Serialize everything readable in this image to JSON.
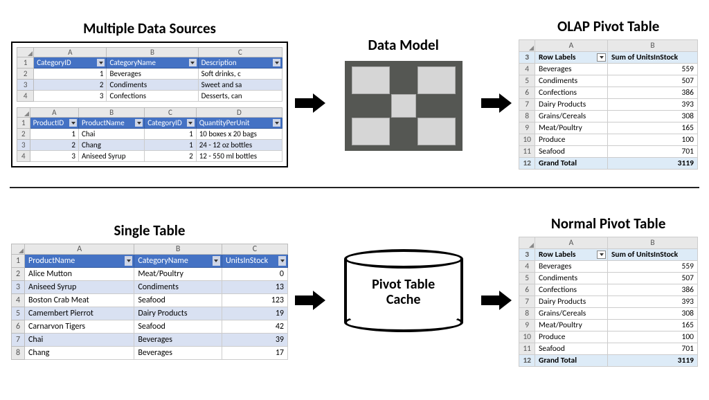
{
  "titles": {
    "multi": "Multiple Data Sources",
    "model": "Data Model",
    "olap": "OLAP Pivot Table",
    "single": "Single Table",
    "normal": "Normal Pivot Table"
  },
  "cache_label_1": "Pivot Table",
  "cache_label_2": "Cache",
  "src1": {
    "cols": [
      "A",
      "B",
      "C"
    ],
    "headers": [
      "CategoryID",
      "CategoryName",
      "Description"
    ],
    "rows": [
      {
        "n": "1",
        "id": "1",
        "name": "Beverages",
        "desc": "Soft drinks, c"
      },
      {
        "n": "2",
        "id": "2",
        "name": "Condiments",
        "desc": "Sweet and sa"
      },
      {
        "n": "3",
        "id": "3",
        "name": "Confections",
        "desc": "Desserts, can"
      }
    ]
  },
  "src2": {
    "cols": [
      "A",
      "B",
      "C",
      "D"
    ],
    "headers": [
      "ProductID",
      "ProductName",
      "CategoryID",
      "QuantityPerUnit"
    ],
    "rows": [
      {
        "n": "1",
        "id": "1",
        "name": "Chai",
        "cat": "1",
        "qpu": "10 boxes x 20 bags"
      },
      {
        "n": "2",
        "id": "2",
        "name": "Chang",
        "cat": "1",
        "qpu": "24 - 12 oz bottles"
      },
      {
        "n": "3",
        "id": "3",
        "name": "Aniseed Syrup",
        "cat": "2",
        "qpu": "12 - 550 ml bottles"
      }
    ]
  },
  "single": {
    "cols": [
      "A",
      "B",
      "C"
    ],
    "headers": [
      "ProductName",
      "CategoryName",
      "UnitsInStock"
    ],
    "rows": [
      {
        "n": "1",
        "p": "Alice Mutton",
        "c": "Meat/Poultry",
        "u": "0"
      },
      {
        "n": "2",
        "p": "Aniseed Syrup",
        "c": "Condiments",
        "u": "13"
      },
      {
        "n": "3",
        "p": "Boston Crab Meat",
        "c": "Seafood",
        "u": "123"
      },
      {
        "n": "4",
        "p": "Camembert Pierrot",
        "c": "Dairy Products",
        "u": "19"
      },
      {
        "n": "5",
        "p": "Carnarvon Tigers",
        "c": "Seafood",
        "u": "42"
      },
      {
        "n": "6",
        "p": "Chai",
        "c": "Beverages",
        "u": "39"
      },
      {
        "n": "7",
        "p": "Chang",
        "c": "Beverages",
        "u": "17"
      }
    ]
  },
  "pivot": {
    "cols": [
      "A",
      "B"
    ],
    "startRow": 3,
    "h1": "Row Labels",
    "h2": "Sum of UnitsInStock",
    "rows": [
      {
        "label": "Beverages",
        "val": "559"
      },
      {
        "label": "Condiments",
        "val": "507"
      },
      {
        "label": "Confections",
        "val": "386"
      },
      {
        "label": "Dairy Products",
        "val": "393"
      },
      {
        "label": "Grains/Cereals",
        "val": "308"
      },
      {
        "label": "Meat/Poultry",
        "val": "165"
      },
      {
        "label": "Produce",
        "val": "100"
      },
      {
        "label": "Seafood",
        "val": "701"
      }
    ],
    "total_label": "Grand Total",
    "total_val": "3119"
  },
  "chart_data": {
    "type": "table",
    "title": "Pivot summary: Sum of UnitsInStock by Category",
    "categories": [
      "Beverages",
      "Condiments",
      "Confections",
      "Dairy Products",
      "Grains/Cereals",
      "Meat/Poultry",
      "Produce",
      "Seafood"
    ],
    "values": [
      559,
      507,
      386,
      393,
      308,
      165,
      100,
      701
    ],
    "total": 3119
  }
}
